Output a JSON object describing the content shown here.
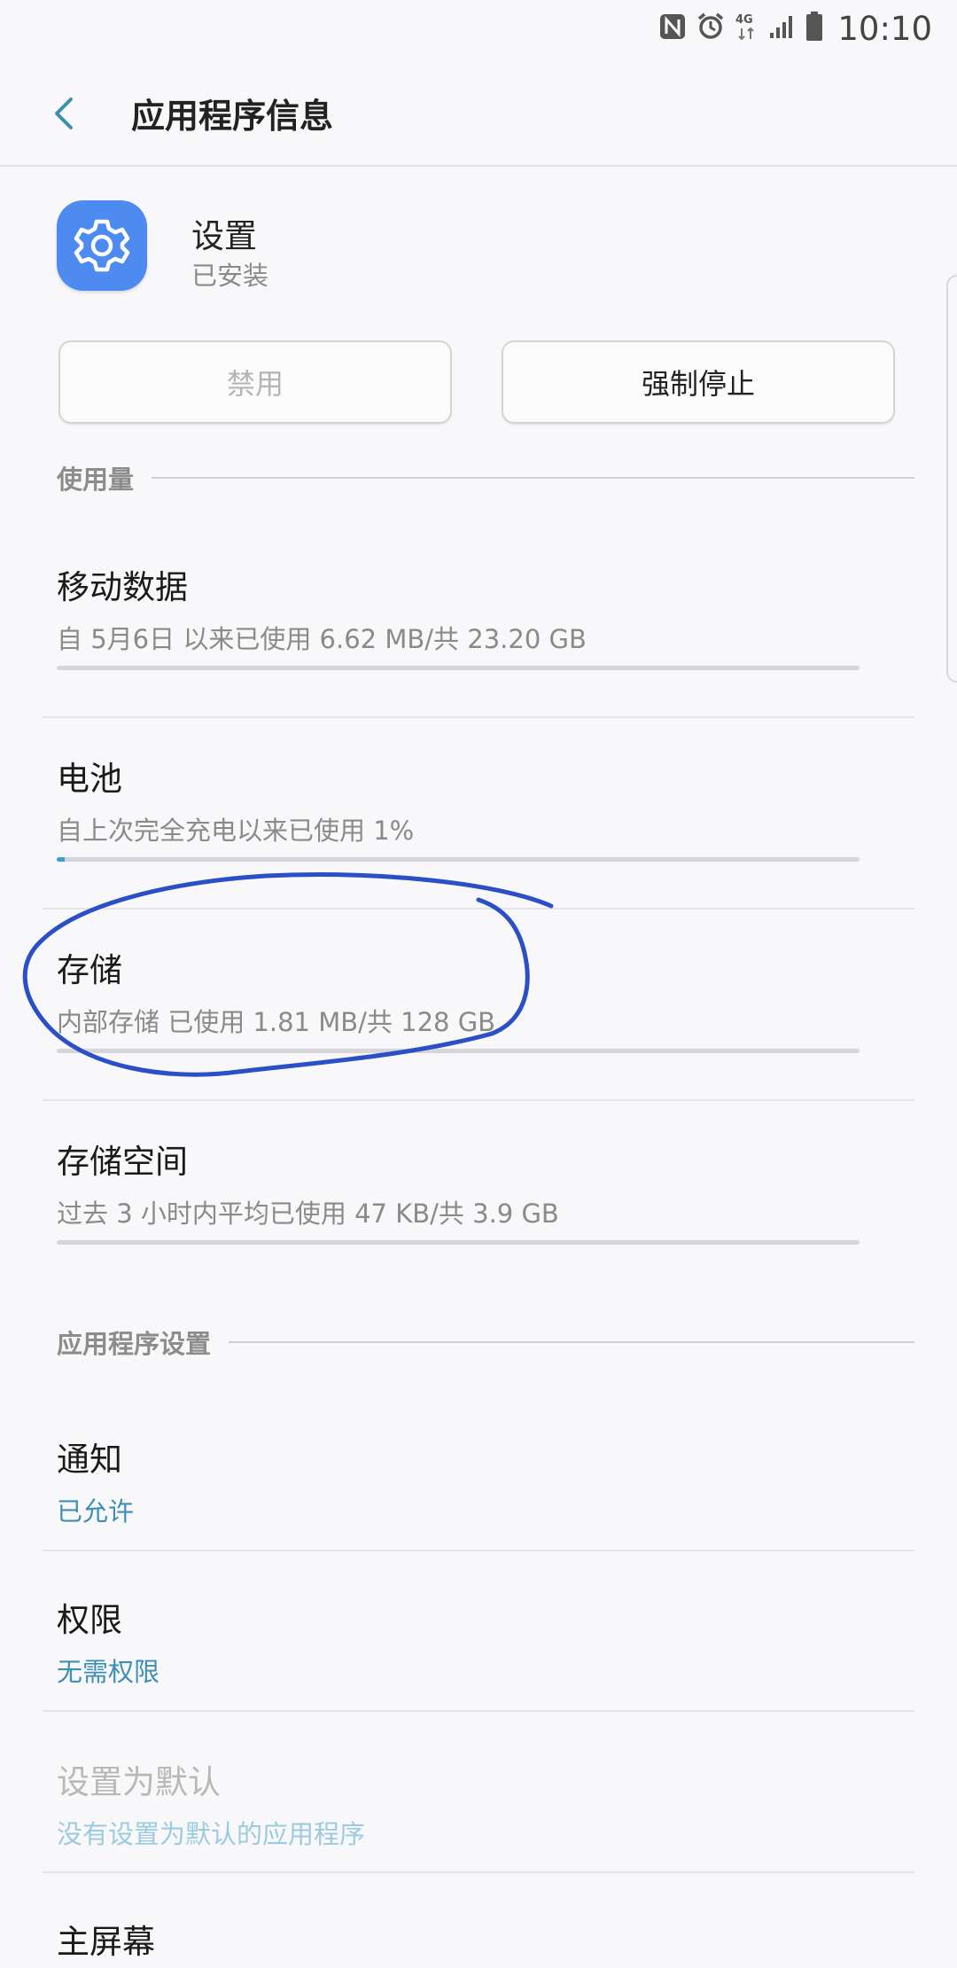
{
  "status_bar": {
    "time": "10:10",
    "network": "4G",
    "icons": [
      "nfc-icon",
      "alarm-icon",
      "network-4g-icon",
      "signal-icon",
      "battery-icon"
    ]
  },
  "app_bar": {
    "title": "应用程序信息",
    "back_icon": "chevron-left-icon"
  },
  "app": {
    "name": "设置",
    "status": "已安装",
    "icon": "gear-icon",
    "icon_color": "#4e8bf0"
  },
  "buttons": {
    "disable": "禁用",
    "force_stop": "强制停止"
  },
  "usage": {
    "header": "使用量",
    "items": [
      {
        "title": "移动数据",
        "subtitle": "自 5月6日 以来已使用 6.62 MB/共 23.20 GB",
        "progress": 0.0
      },
      {
        "title": "电池",
        "subtitle": "自上次完全充电以来已使用 1%",
        "progress": 0.01
      },
      {
        "title": "存储",
        "subtitle": "内部存储 已使用 1.81 MB/共 128 GB",
        "progress": 0.0
      },
      {
        "title": "存储空间",
        "subtitle": "过去 3 小时内平均已使用 47 KB/共 3.9 GB",
        "progress": 0.0
      }
    ]
  },
  "app_settings": {
    "header": "应用程序设置",
    "items": [
      {
        "title": "通知",
        "subtitle": "已允许"
      },
      {
        "title": "权限",
        "subtitle": "无需权限"
      },
      {
        "title": "设置为默认",
        "subtitle": "没有设置为默认的应用程序"
      },
      {
        "title": "主屏幕"
      }
    ]
  },
  "colors": {
    "accent": "#3d8fb3",
    "progress_fill": "#3ea0c8",
    "annotation_stroke": "#2a4fc7"
  }
}
